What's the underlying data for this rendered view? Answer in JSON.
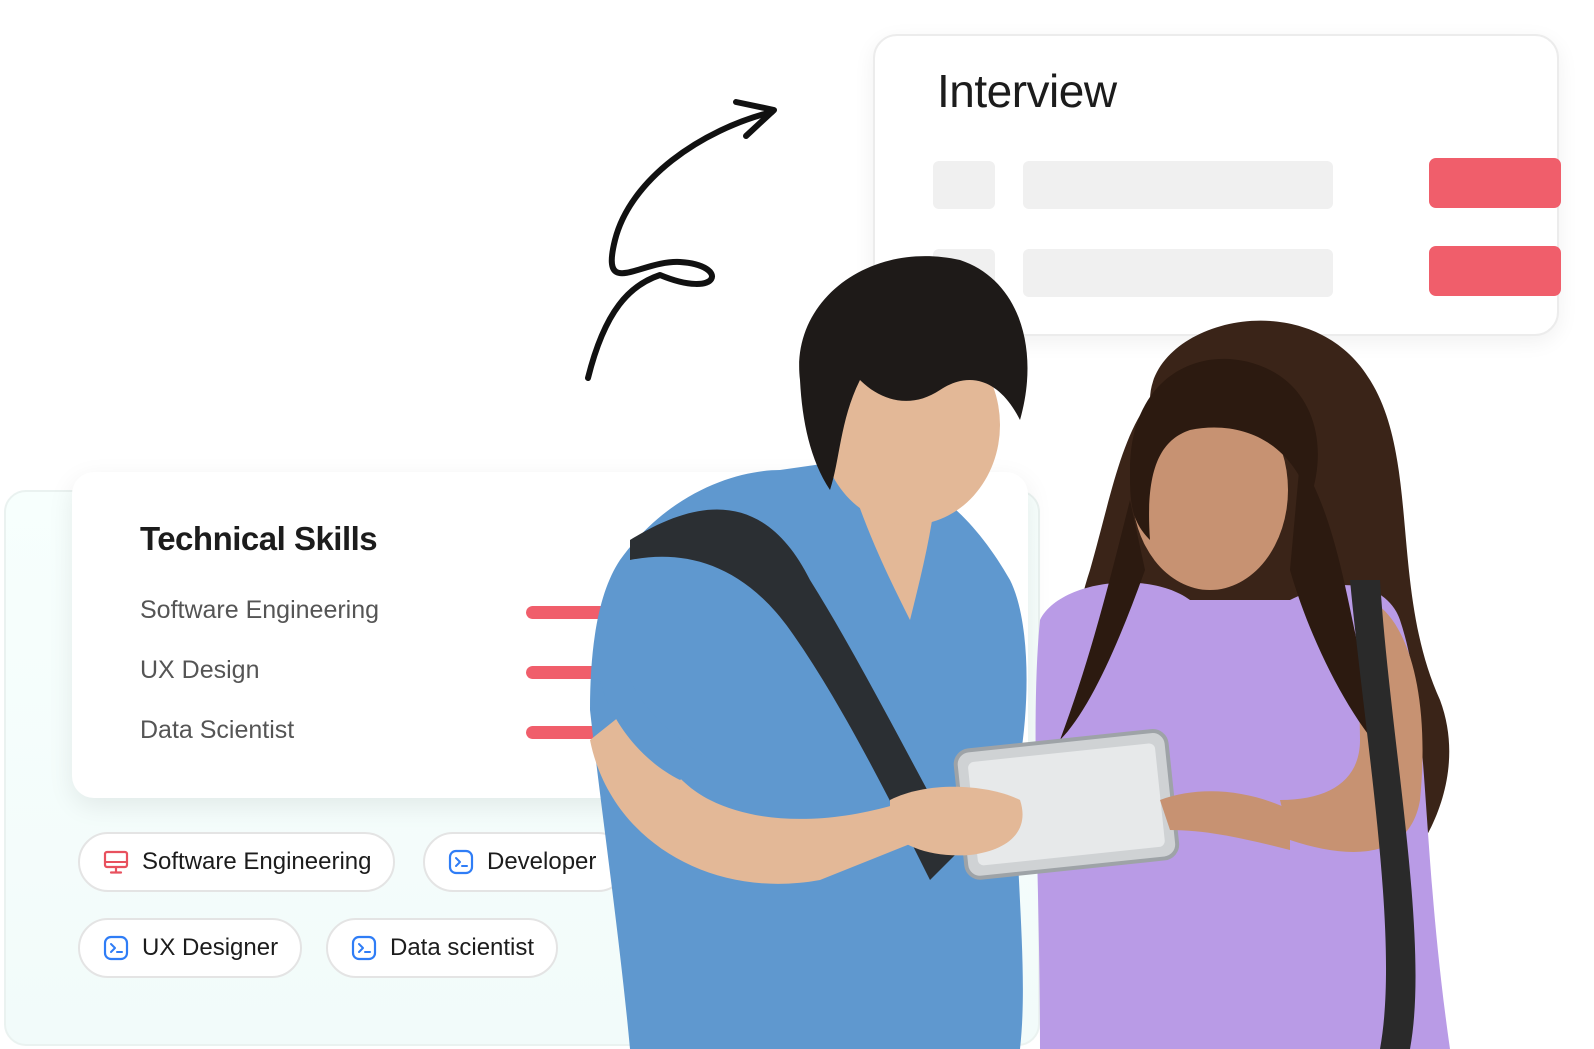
{
  "interview": {
    "title": "Interview"
  },
  "technical_skills": {
    "title": "Technical Skills",
    "skills": [
      {
        "label": "Software Engineering",
        "level": 0.65
      },
      {
        "label": "UX Design",
        "level": 0.9
      },
      {
        "label": "Data Scientist",
        "level": 0.65
      }
    ]
  },
  "tags": [
    {
      "label": "Software Engineering",
      "icon": "monitor-icon",
      "color": "#e8515e"
    },
    {
      "label": "Developer",
      "icon": "terminal-icon",
      "color": "#2f7df6"
    },
    {
      "label": "UX Designer",
      "icon": "terminal-icon",
      "color": "#2f7df6"
    },
    {
      "label": "Data scientist",
      "icon": "terminal-icon",
      "color": "#2f7df6"
    }
  ],
  "colors": {
    "accent": "#f05e6b",
    "accent_light": "#fbe5e7",
    "icon_blue": "#2f7df6",
    "panel_tint": "#f4fcfb"
  }
}
